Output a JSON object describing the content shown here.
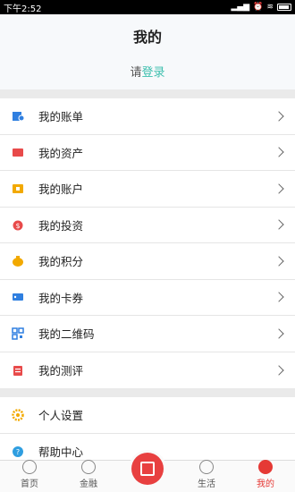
{
  "status_bar": {
    "time": "下午2:52"
  },
  "header": {
    "title": "我的",
    "login_prefix": "请",
    "login_link": "登录"
  },
  "menu_group_1": [
    {
      "label": "我的账单",
      "icon": "bill-icon",
      "color": "#2f7fe0"
    },
    {
      "label": "我的资产",
      "icon": "assets-icon",
      "color": "#e84a4a"
    },
    {
      "label": "我的账户",
      "icon": "account-icon",
      "color": "#f2a900"
    },
    {
      "label": "我的投资",
      "icon": "investment-icon",
      "color": "#e84a4a"
    },
    {
      "label": "我的积分",
      "icon": "points-icon",
      "color": "#f2a900"
    },
    {
      "label": "我的卡券",
      "icon": "coupon-icon",
      "color": "#2f7fe0"
    },
    {
      "label": "我的二维码",
      "icon": "qrcode-icon",
      "color": "#2f7fe0"
    },
    {
      "label": "我的测评",
      "icon": "evaluation-icon",
      "color": "#e84a4a"
    }
  ],
  "menu_group_2": [
    {
      "label": "个人设置",
      "icon": "gear-icon",
      "color": "#f2a900"
    },
    {
      "label": "帮助中心",
      "icon": "help-icon",
      "color": "#2f9ee0"
    }
  ],
  "tabbar": {
    "tabs": [
      {
        "label": "首页",
        "icon": "home-icon"
      },
      {
        "label": "金融",
        "icon": "finance-icon"
      },
      {
        "label": "",
        "icon": "scan-icon"
      },
      {
        "label": "生活",
        "icon": "life-icon"
      },
      {
        "label": "我的",
        "icon": "profile-icon"
      }
    ],
    "active_color": "#e53935"
  }
}
